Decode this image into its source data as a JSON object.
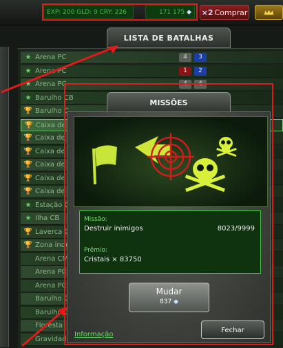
{
  "topbar": {
    "stats": "EXP: 200 GLD: 9 CRY: 226",
    "crystals": "171 175",
    "crystal_symbol": "◆",
    "buy_multiplier": "×2",
    "buy_label": "Comprar"
  },
  "battle_list": {
    "title": "LISTA DE BATALHAS",
    "rows": [
      {
        "icon": "★",
        "name": "Arena PC",
        "s1": "4",
        "s2": "3",
        "c1": "g",
        "c2": "b"
      },
      {
        "icon": "★",
        "name": "Arena PC",
        "s1": "1",
        "s2": "2",
        "c1": "r",
        "c2": "b"
      },
      {
        "icon": "★",
        "name": "Arena PC",
        "s1": "4",
        "s2": "4",
        "c1": "g",
        "c2": "g"
      },
      {
        "icon": "★",
        "name": "Barulho CB"
      },
      {
        "icon": "🏆",
        "name": "Barulho C"
      },
      {
        "icon": "🏆",
        "name": "Caixa de a"
      },
      {
        "icon": "🏆",
        "name": "Caixa de a"
      },
      {
        "icon": "🏆",
        "name": "Caixa de a"
      },
      {
        "icon": "🏆",
        "name": "Caixa de a"
      },
      {
        "icon": "🏆",
        "name": "Caixa de a"
      },
      {
        "icon": "🏆",
        "name": "Caixa de a"
      },
      {
        "icon": "★",
        "name": "Estação C"
      },
      {
        "icon": "★",
        "name": "Ilha CB"
      },
      {
        "icon": "🏆",
        "name": "Laverca C"
      },
      {
        "icon": "🏆",
        "name": "Zona indu"
      },
      {
        "icon": "",
        "name": "Arena CM"
      },
      {
        "icon": "",
        "name": "Arena PC"
      },
      {
        "icon": "",
        "name": "Arena PC"
      },
      {
        "icon": "",
        "name": "Barulho C"
      },
      {
        "icon": "",
        "name": "Barulho C"
      },
      {
        "icon": "",
        "name": "Floresta"
      },
      {
        "icon": "",
        "name": "Gravidade"
      }
    ]
  },
  "missions": {
    "title": "MISSÕES",
    "mission_label": "Missão:",
    "mission_value": "Destruir inimigos",
    "mission_progress": "8023/9999",
    "reward_label": "Prêmio:",
    "reward_value": "Cristais × 83750",
    "change_label": "Mudar",
    "change_price": "837",
    "close_label": "Fechar",
    "info_link": "Informação"
  },
  "colors": {
    "highlight": "#e01b1b",
    "accent_green": "#3fc43f"
  }
}
